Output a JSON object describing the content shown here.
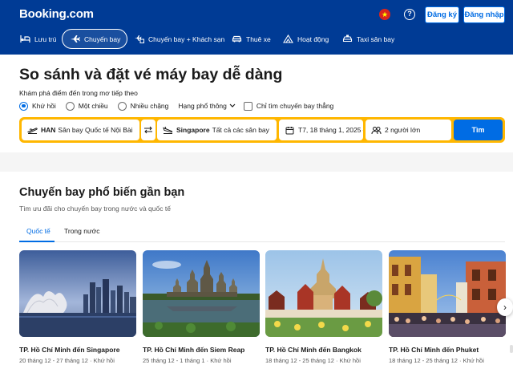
{
  "header": {
    "logo": "Booking.com",
    "flag_glyph": "★",
    "help_glyph": "?",
    "register": "Đăng ký",
    "login": "Đăng nhập"
  },
  "nav": [
    {
      "label": "Lưu trú",
      "icon": "bed-icon",
      "active": false
    },
    {
      "label": "Chuyến bay",
      "icon": "plane-icon",
      "active": true
    },
    {
      "label": "Chuyến bay + Khách sạn",
      "icon": "plane-hotel-icon",
      "active": false
    },
    {
      "label": "Thuê xe",
      "icon": "car-icon",
      "active": false
    },
    {
      "label": "Hoạt động",
      "icon": "attractions-icon",
      "active": false
    },
    {
      "label": "Taxi sân bay",
      "icon": "taxi-icon",
      "active": false
    }
  ],
  "search": {
    "title": "So sánh và đặt vé máy bay dễ dàng",
    "subtitle": "Khám phá điểm đến trong mơ tiếp theo",
    "trip_types": [
      "Khứ hồi",
      "Một chiều",
      "Nhiều chặng"
    ],
    "trip_type_selected": "Khứ hồi",
    "cabin_class": "Hạng phổ thông",
    "direct_only": "Chỉ tìm chuyến bay thẳng",
    "origin_code": "HAN",
    "origin_name": "Sân bay Quốc tế Nội Bài",
    "destination_code": "Singapore",
    "destination_name": "Tất cả các sân bay",
    "date": "T7, 18 tháng 1, 2025 —",
    "travellers": "2 người lớn",
    "button": "Tìm"
  },
  "popular": {
    "title": "Chuyến bay phổ biến gần bạn",
    "subtitle": "Tìm ưu đãi cho chuyến bay trong nước và quốc tế",
    "tabs": [
      "Quốc tế",
      "Trong nước"
    ],
    "active_tab": "Quốc tế",
    "cards": [
      {
        "title": "TP. Hồ Chí Minh đến Singapore",
        "dates": "20 tháng 12 - 27 tháng 12 · Khứ hồi"
      },
      {
        "title": "TP. Hồ Chí Minh đến Siem Reap",
        "dates": "25 tháng 12 - 1 tháng 1 · Khứ hồi"
      },
      {
        "title": "TP. Hồ Chí Minh đến Bangkok",
        "dates": "18 tháng 12 - 25 tháng 12 · Khứ hồi"
      },
      {
        "title": "TP. Hồ Chí Minh đến Phuket",
        "dates": "18 tháng 12 - 25 tháng 12 · Khứ hồi"
      }
    ],
    "next_glyph": "›"
  },
  "colors": {
    "brand_blue": "#003b95",
    "action_blue": "#006ce4",
    "search_border": "#ffb700"
  }
}
